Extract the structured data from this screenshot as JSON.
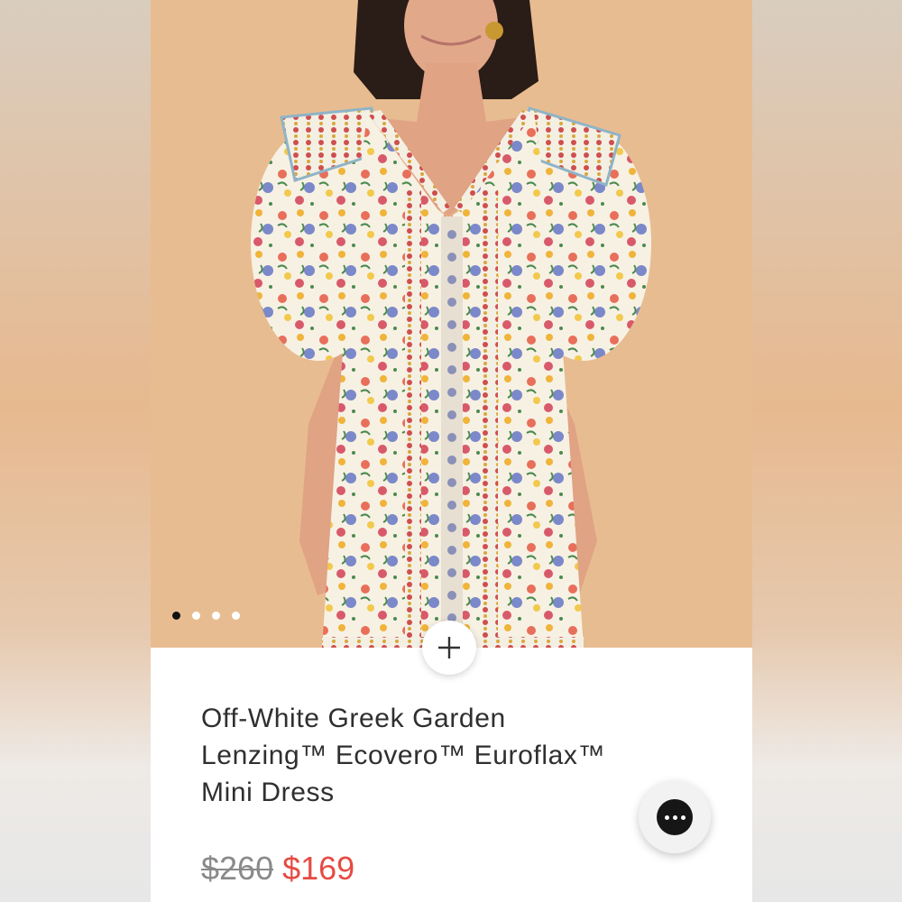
{
  "product": {
    "title_lines": [
      "Off-White Greek Garden",
      "Lenzing™ Ecovero™ Euroflax™",
      "Mini Dress"
    ],
    "original_price": "$260",
    "sale_price": "$169"
  },
  "gallery": {
    "image_count": 4,
    "active_index": 0,
    "image_subject": "model-in-floral-dress"
  },
  "icons": {
    "zoom": "plus-icon",
    "chat": "chat-bubble-icon"
  },
  "colors": {
    "sale_price": "#e54b43",
    "original_price": "#8a8a8a",
    "hero_background": "#e8bc91"
  }
}
